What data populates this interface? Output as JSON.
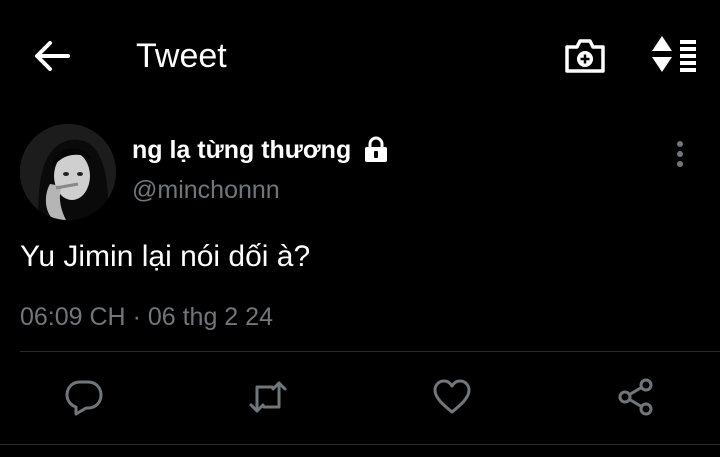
{
  "header": {
    "title": "Tweet",
    "back_icon": "arrow-left-icon",
    "camera_icon": "camera-add-icon",
    "sort_icon": "sort-list-icon"
  },
  "tweet": {
    "author": {
      "display_name": "ng lạ từng thương",
      "username": "@minchonnn",
      "protected_icon": "lock-icon"
    },
    "text": "Yu Jimin lại nói dối à?",
    "time": "06:09 CH",
    "separator": "·",
    "date": "06 thg 2 24"
  },
  "actions": [
    {
      "name": "reply",
      "icon": "reply-icon"
    },
    {
      "name": "retweet",
      "icon": "retweet-icon"
    },
    {
      "name": "like",
      "icon": "heart-icon"
    },
    {
      "name": "share",
      "icon": "share-icon"
    }
  ],
  "colors": {
    "background": "#000000",
    "text_primary": "#ffffff",
    "text_secondary": "#71767b",
    "icon_muted": "#71767b",
    "divider": "#2a2a2a"
  }
}
